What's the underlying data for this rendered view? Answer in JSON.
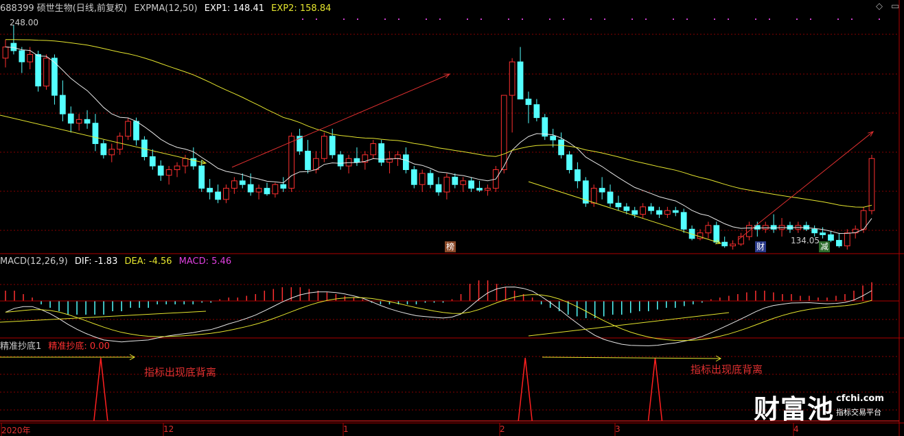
{
  "header": {
    "ticker": "688399 硕世生物(日线,前复权)",
    "indicator": "EXPMA(12,50)",
    "exp1": "EXP1: 148.41",
    "exp2": "EXP2: 158.84",
    "max_price": "248.00",
    "min_price": "134.05"
  },
  "macd_header": {
    "name": "MACD(12,26,9)",
    "dif": "DIF: -1.83",
    "dea": "DEA: -4.56",
    "macd": "MACD: 5.46"
  },
  "sig_header": {
    "name": "精准抄底1",
    "value": "精准抄底: 0.00"
  },
  "annotations": {
    "divergence1": "指标出现底背离",
    "divergence2": "指标出现底背离"
  },
  "badges": {
    "bang": "榜",
    "cai": "财",
    "jian": "减"
  },
  "xaxis": {
    "labels": [
      "2020年",
      "12",
      "1",
      "2",
      "3",
      "4"
    ]
  },
  "watermark": {
    "brand": "财富池",
    "site": "cfchi.com",
    "slogan": "指标交易平台"
  },
  "colors": {
    "up": "#ff3030",
    "down": "#54ffff",
    "exp1": "#e8e8e8",
    "exp2": "#e6e62e",
    "grid": "#8b0000"
  },
  "chart_data": [
    {
      "type": "candlestick",
      "title": "688399 硕世生物(日线,前复权)",
      "ylim": [
        134.05,
        248.0
      ],
      "candles": [
        [
          230,
          240,
          225,
          236
        ],
        [
          238,
          248,
          232,
          234
        ],
        [
          234,
          236,
          222,
          228
        ],
        [
          228,
          236,
          224,
          232
        ],
        [
          232,
          234,
          212,
          215
        ],
        [
          215,
          232,
          213,
          230
        ],
        [
          230,
          232,
          205,
          210
        ],
        [
          210,
          218,
          196,
          200
        ],
        [
          200,
          204,
          190,
          195
        ],
        [
          195,
          200,
          191,
          197
        ],
        [
          197,
          202,
          192,
          195
        ],
        [
          195,
          200,
          180,
          184
        ],
        [
          184,
          186,
          176,
          178
        ],
        [
          178,
          184,
          174,
          181
        ],
        [
          181,
          190,
          178,
          188
        ],
        [
          188,
          198,
          186,
          196
        ],
        [
          196,
          198,
          183,
          186
        ],
        [
          186,
          188,
          175,
          177
        ],
        [
          177,
          181,
          170,
          172
        ],
        [
          172,
          175,
          164,
          167
        ],
        [
          167,
          172,
          162,
          170
        ],
        [
          170,
          174,
          166,
          172
        ],
        [
          172,
          178,
          168,
          176
        ],
        [
          176,
          182,
          170,
          172
        ],
        [
          172,
          175,
          158,
          160
        ],
        [
          160,
          165,
          154,
          158
        ],
        [
          158,
          162,
          152,
          154
        ],
        [
          154,
          162,
          152,
          160
        ],
        [
          160,
          166,
          157,
          164
        ],
        [
          164,
          168,
          160,
          162
        ],
        [
          162,
          168,
          156,
          158
        ],
        [
          158,
          162,
          154,
          160
        ],
        [
          160,
          163,
          156,
          157
        ],
        [
          157,
          163,
          155,
          162
        ],
        [
          162,
          166,
          158,
          160
        ],
        [
          160,
          190,
          158,
          188
        ],
        [
          188,
          192,
          178,
          180
        ],
        [
          180,
          186,
          168,
          170
        ],
        [
          170,
          180,
          168,
          176
        ],
        [
          176,
          190,
          174,
          188
        ],
        [
          188,
          192,
          176,
          178
        ],
        [
          178,
          180,
          170,
          172
        ],
        [
          172,
          178,
          168,
          176
        ],
        [
          176,
          182,
          172,
          174
        ],
        [
          174,
          180,
          170,
          178
        ],
        [
          178,
          186,
          176,
          184
        ],
        [
          184,
          186,
          172,
          174
        ],
        [
          174,
          180,
          168,
          176
        ],
        [
          176,
          180,
          172,
          178
        ],
        [
          178,
          182,
          168,
          170
        ],
        [
          170,
          172,
          160,
          162
        ],
        [
          162,
          170,
          158,
          168
        ],
        [
          168,
          170,
          160,
          162
        ],
        [
          162,
          166,
          156,
          158
        ],
        [
          158,
          168,
          154,
          166
        ],
        [
          166,
          168,
          160,
          162
        ],
        [
          162,
          166,
          158,
          164
        ],
        [
          164,
          166,
          158,
          160
        ],
        [
          160,
          164,
          158,
          159
        ],
        [
          159,
          162,
          156,
          160
        ],
        [
          160,
          172,
          158,
          170
        ],
        [
          170,
          210,
          168,
          210
        ],
        [
          210,
          230,
          190,
          228
        ],
        [
          228,
          236,
          215,
          208
        ],
        [
          208,
          212,
          195,
          205
        ],
        [
          205,
          208,
          196,
          198
        ],
        [
          198,
          200,
          186,
          188
        ],
        [
          188,
          192,
          182,
          186
        ],
        [
          186,
          190,
          176,
          178
        ],
        [
          178,
          180,
          168,
          170
        ],
        [
          170,
          174,
          160,
          164
        ],
        [
          164,
          166,
          150,
          152
        ],
        [
          152,
          162,
          150,
          160
        ],
        [
          160,
          166,
          154,
          158
        ],
        [
          158,
          162,
          150,
          152
        ],
        [
          152,
          156,
          148,
          150
        ],
        [
          150,
          152,
          146,
          148
        ],
        [
          148,
          150,
          144,
          146
        ],
        [
          146,
          152,
          144,
          150
        ],
        [
          150,
          152,
          146,
          148
        ],
        [
          148,
          150,
          144,
          146
        ],
        [
          146,
          150,
          144,
          148
        ],
        [
          148,
          150,
          145,
          147
        ],
        [
          147,
          149,
          136,
          138
        ],
        [
          138,
          140,
          132,
          133
        ],
        [
          133,
          138,
          132,
          136
        ],
        [
          136,
          142,
          133,
          140
        ],
        [
          140,
          142,
          130,
          131
        ],
        [
          131,
          134,
          128,
          129
        ],
        [
          129,
          132,
          127,
          130
        ],
        [
          130,
          136,
          129,
          134
        ],
        [
          134,
          142,
          132,
          140
        ],
        [
          140,
          142,
          134,
          138
        ],
        [
          138,
          142,
          136,
          140
        ],
        [
          140,
          146,
          136,
          138
        ],
        [
          138,
          144,
          134,
          140
        ],
        [
          140,
          142,
          136,
          138
        ],
        [
          138,
          142,
          136,
          140
        ],
        [
          140,
          142,
          137,
          138
        ],
        [
          138,
          140,
          134,
          136
        ],
        [
          136,
          139,
          133,
          135
        ],
        [
          135,
          137,
          131,
          132
        ],
        [
          132,
          136,
          128,
          129
        ],
        [
          129,
          138,
          127,
          136
        ],
        [
          136,
          140,
          133,
          138
        ],
        [
          138,
          150,
          136,
          148
        ],
        [
          148,
          178,
          146,
          176
        ]
      ],
      "exp1_range": [
        134.05,
        248.0
      ],
      "exp2_range": [
        134.05,
        248.0
      ]
    },
    {
      "type": "bar",
      "title": "MACD(12,26,9)",
      "series": [
        {
          "name": "DIF",
          "last": -1.83
        },
        {
          "name": "DEA",
          "last": -4.56
        },
        {
          "name": "MACD",
          "last": 5.46
        }
      ],
      "hist": [
        3,
        3,
        2,
        1,
        -1,
        -2,
        -3,
        -4,
        -4,
        -4,
        -4,
        -4,
        -3,
        -3,
        -2,
        -2,
        -2,
        -1,
        -1,
        -1,
        -1,
        -1,
        -0.5,
        -0.5,
        0.5,
        1,
        1,
        1.5,
        2,
        3,
        3.5,
        4,
        4,
        4,
        3.5,
        3,
        2.5,
        2,
        1.5,
        1,
        0.5,
        -0.5,
        -1,
        -1,
        -1,
        -1,
        -1,
        -0.5,
        -0.5,
        -0.5,
        0.5,
        2,
        5,
        6,
        6,
        5,
        4,
        3,
        2,
        1,
        -1,
        -2,
        -3,
        -4,
        -4.5,
        -5,
        -5,
        -4.5,
        -4,
        -4,
        -3.5,
        -3,
        -3,
        -2.5,
        -2,
        -2,
        -1.5,
        -1,
        -0.5,
        0.5,
        1,
        1.5,
        2,
        2.5,
        3,
        3,
        2.5,
        2,
        2,
        1.5,
        1.5,
        1,
        1,
        1.5,
        2,
        3,
        4.5,
        5.46
      ]
    },
    {
      "type": "line",
      "title": "精准抄底1",
      "series": [
        {
          "name": "精准抄底",
          "last": 0.0
        }
      ],
      "spikes_at_fraction": [
        0.11,
        0.6,
        0.75
      ]
    }
  ]
}
